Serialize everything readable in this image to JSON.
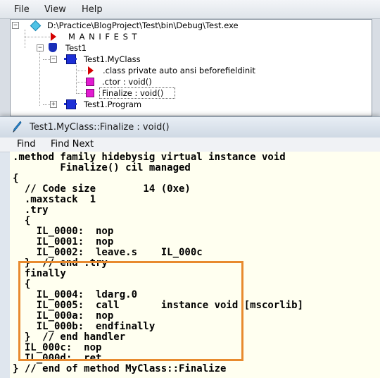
{
  "main_window": {
    "menu": [
      "File",
      "View",
      "Help"
    ],
    "tree": {
      "root_label": "D:\\Practice\\BlogProject\\Test\\bin\\Debug\\Test.exe",
      "manifest_label": "M A N I F E S T",
      "namespace_label": "Test1",
      "class_label": "Test1.MyClass",
      "class_decl_label": ".class private auto ansi beforefieldinit",
      "ctor_label": ".ctor : void()",
      "finalize_label": "Finalize : void()",
      "program_label": "Test1.Program"
    }
  },
  "code_window": {
    "title": "Test1.MyClass::Finalize : void()",
    "menu": [
      "Find",
      "Find Next"
    ],
    "code_lines": [
      ".method family hidebysig virtual instance void",
      "        Finalize() cil managed",
      "{",
      "  // Code size        14 (0xe)",
      "  .maxstack  1",
      "  .try",
      "  {",
      "    IL_0000:  nop",
      "    IL_0001:  nop",
      "    IL_0002:  leave.s    IL_000c",
      "  }  // end .try",
      "  finally",
      "  {",
      "    IL_0004:  ldarg.0",
      "    IL_0005:  call       instance void [mscorlib]",
      "    IL_000a:  nop",
      "    IL_000b:  endfinally",
      "  }  // end handler",
      "  IL_000c:  nop",
      "  IL_000d:  ret",
      "} // end of method MyClass::Finalize"
    ]
  },
  "colors": {
    "highlight_box": "#e88a2e",
    "code_background": "#fffff0"
  }
}
